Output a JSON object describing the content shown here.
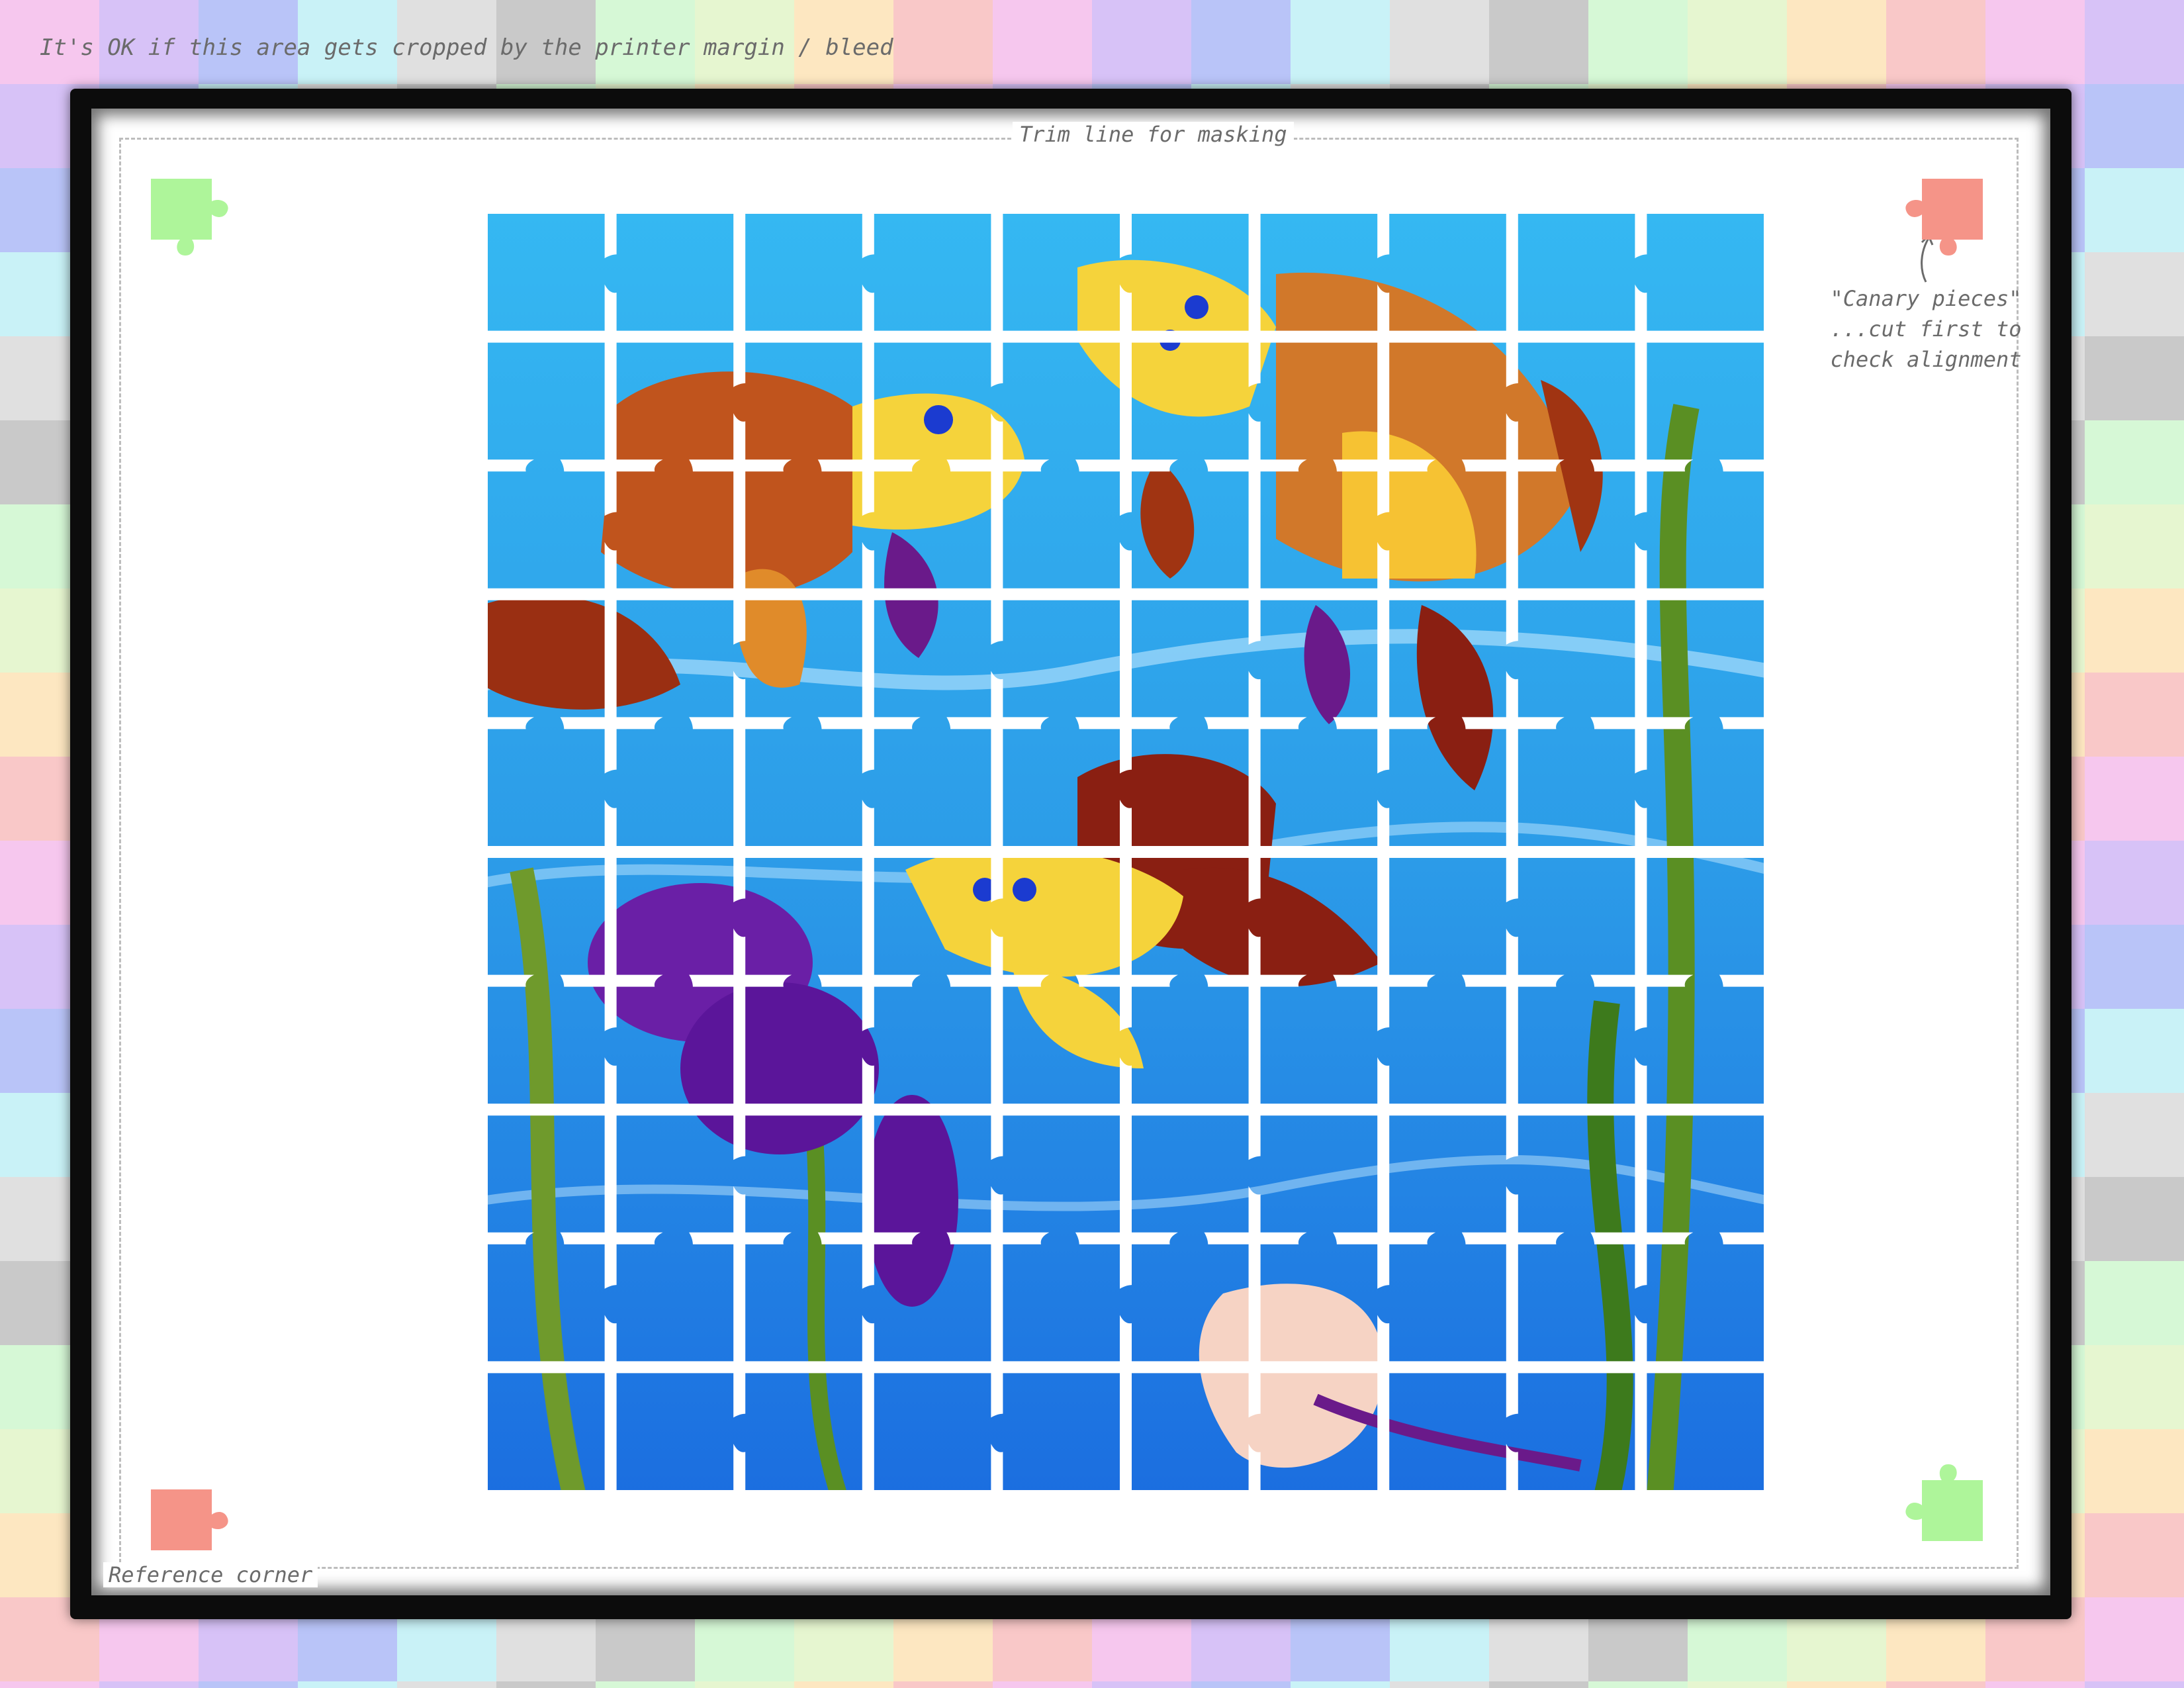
{
  "notes": {
    "bleed": "It's OK if this area gets cropped by the printer margin / bleed",
    "trim_line": "Trim line for masking",
    "reference_corner": "Reference corner",
    "canary_line1": "\"Canary pieces\"",
    "canary_line2": "...cut first to",
    "canary_line3": "check alignment"
  },
  "colors": {
    "green_canary": "#aef59a",
    "red_canary": "#f59488",
    "frame": "#0c0c0c",
    "bleed_palette": [
      "#f6c7ee",
      "#d7c2f7",
      "#b9c4f8",
      "#c9f2f7",
      "#e0e0e0",
      "#c9c9c9",
      "#d6f8d6",
      "#e6f6d0",
      "#fde7c1",
      "#f9c8c8"
    ]
  },
  "icons": {
    "top_left": "green-puzzle-piece-icon",
    "top_right": "red-puzzle-piece-icon",
    "bottom_left": "red-puzzle-piece-icon",
    "bottom_right": "green-puzzle-piece-icon"
  },
  "puzzle": {
    "rows": 10,
    "cols": 10
  }
}
